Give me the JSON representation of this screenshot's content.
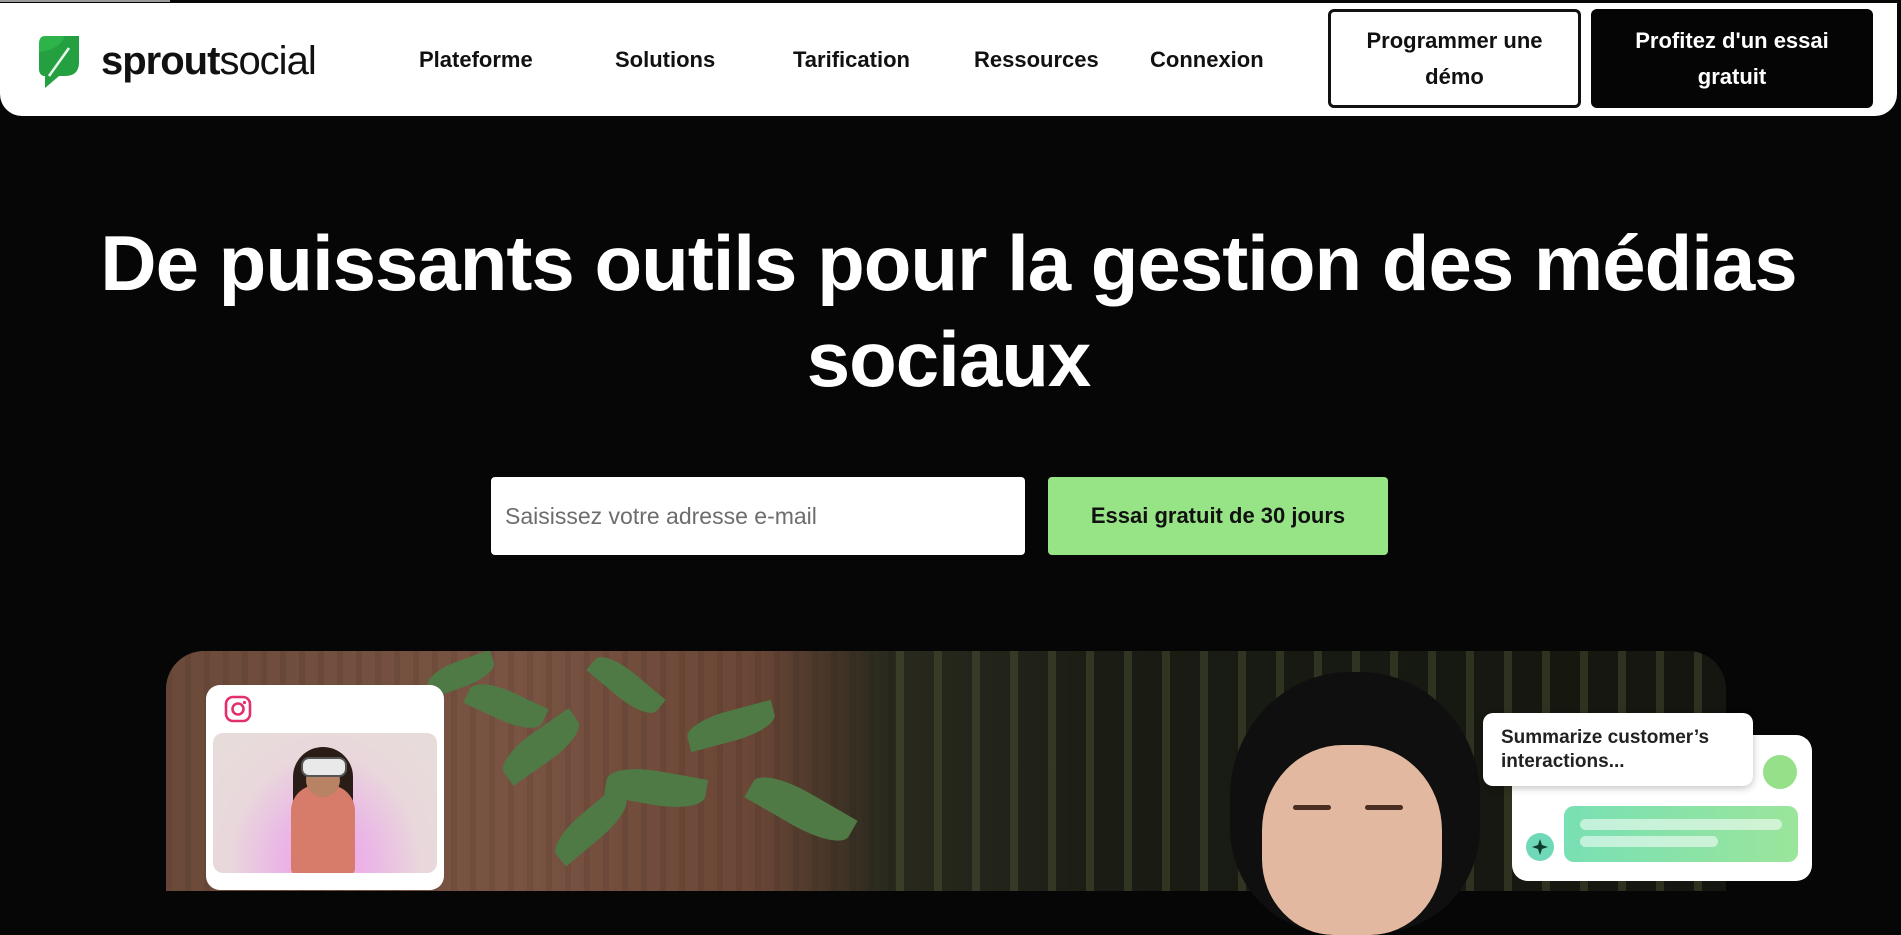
{
  "brand": {
    "name_bold": "sprout",
    "name_regular": "social",
    "logo_color": "#2db34a"
  },
  "nav": {
    "items": [
      {
        "label": "Plateforme"
      },
      {
        "label": "Solutions"
      },
      {
        "label": "Tarification"
      },
      {
        "label": "Ressources"
      },
      {
        "label": "Connexion"
      }
    ],
    "demo_button": "Programmer une démo",
    "trial_button": "Profitez d'un essai gratuit"
  },
  "hero": {
    "title_line1": "De puissants outils pour la gestion des médias",
    "title_line2": "sociaux",
    "email_placeholder": "Saisissez votre adresse e-mail",
    "cta_label": "Essai gratuit de 30 jours",
    "cta_color": "#97e486"
  },
  "ai_card": {
    "prompt": "Summarize customer’s interactions..."
  },
  "instagram_card": {
    "icon": "instagram-icon"
  }
}
